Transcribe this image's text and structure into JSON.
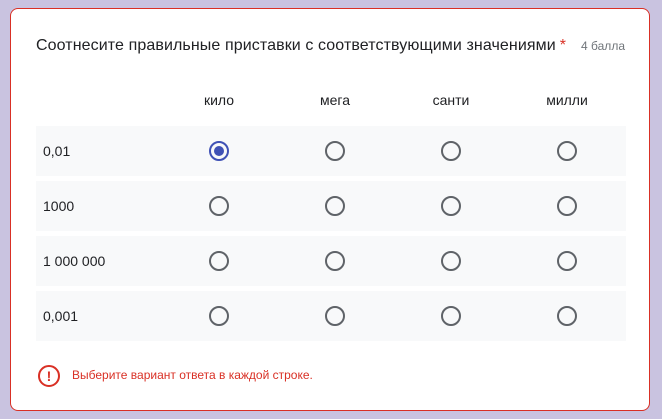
{
  "question": {
    "title": "Соотнесите правильные приставки с соответствующими значениями",
    "required_mark": "*",
    "points": "4 балла"
  },
  "columns": [
    "кило",
    "мега",
    "санти",
    "милли"
  ],
  "rows": [
    {
      "label": "0,01",
      "selected": "кило"
    },
    {
      "label": "1000",
      "selected": null
    },
    {
      "label": "1 000 000",
      "selected": null
    },
    {
      "label": "0,001",
      "selected": null
    }
  ],
  "validation": {
    "icon": "exclamation-icon",
    "icon_glyph": "!",
    "message": "Выберите вариант ответа в каждой строке."
  },
  "colors": {
    "accent": "#3f51b5",
    "error": "#d93025",
    "row_background": "#f8f9fa",
    "page_background": "#c9c3e0"
  }
}
